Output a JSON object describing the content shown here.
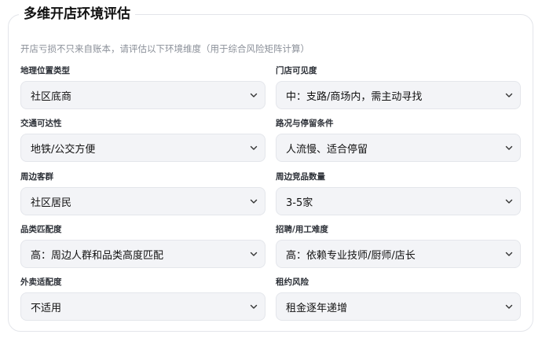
{
  "section": {
    "title": "多维开店环境评估",
    "subtitle": "开店亏损不只来自账本，请评估以下环境维度（用于综合风险矩阵计算）"
  },
  "fields": [
    {
      "label": "地理位置类型",
      "value": "社区底商"
    },
    {
      "label": "门店可见度",
      "value": "中：支路/商场内，需主动寻找"
    },
    {
      "label": "交通可达性",
      "value": "地铁/公交方便"
    },
    {
      "label": "路况与停留条件",
      "value": "人流慢、适合停留"
    },
    {
      "label": "周边客群",
      "value": "社区居民"
    },
    {
      "label": "周边竞品数量",
      "value": "3-5家"
    },
    {
      "label": "品类匹配度",
      "value": "高：周边人群和品类高度匹配"
    },
    {
      "label": "招聘/用工难度",
      "value": "高：依赖专业技师/厨师/店长"
    },
    {
      "label": "外卖适配度",
      "value": "不适用"
    },
    {
      "label": "租约风险",
      "value": "租金逐年递增"
    }
  ],
  "icons": {
    "dropdown": "chevron-down-icon"
  }
}
